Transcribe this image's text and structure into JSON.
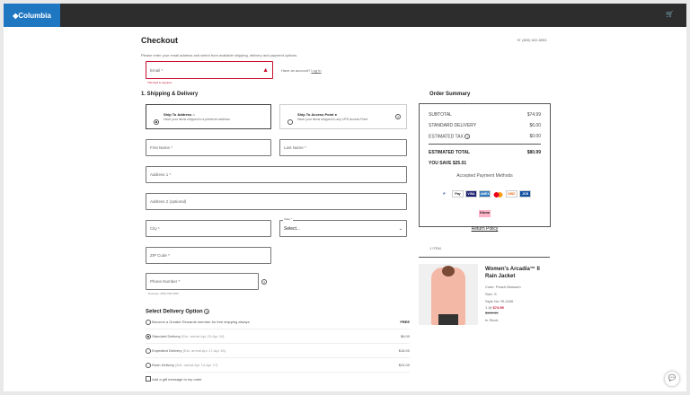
{
  "header": {
    "logo": "◆Columbia",
    "cart_icon": "cart-icon"
  },
  "page": {
    "title": "Checkout",
    "phone": "☏ (800) 622-6953",
    "intro": "Please enter your email address and select from available shipping, delivery and payment options."
  },
  "email": {
    "placeholder": "Email *",
    "error": "This field is required.",
    "account_text": "Have an account?",
    "login": "Log In"
  },
  "shipping": {
    "title": "1. Shipping & Delivery",
    "options": [
      {
        "label": "Ship To Address",
        "desc": "Have your items shipped to a preferred address",
        "selected": true
      },
      {
        "label": "Ship To Access Point",
        "desc": "Have your items shipped to any UPS Access Point",
        "selected": false
      }
    ],
    "fields": {
      "first": "First Name *",
      "last": "Last Name *",
      "addr1": "Address 1 *",
      "addr2": "Address 2 (optional)",
      "city": "City *",
      "state_label": "State *",
      "state_value": "Select...",
      "zip": "ZIP Code *",
      "phone": "Phone Number *",
      "phone_hint": "Example: (555) 555-5555"
    }
  },
  "delivery": {
    "title": "Select Delivery Option",
    "options": [
      {
        "label": "Become a Greater Rewards member for free shipping always",
        "eta": "",
        "price": "FREE",
        "selected": false
      },
      {
        "label": "Standard Delivery",
        "eta": "(Est. arrival Apr 20-Apr 24)",
        "price": "$6.00",
        "selected": true
      },
      {
        "label": "Expedited Delivery",
        "eta": "(Est. arrival Apr 17-Apr 18)",
        "price": "$16.00",
        "selected": false
      },
      {
        "label": "Rush Delivery",
        "eta": "(Est. arrival Apr 14-Apr 17)",
        "price": "$24.00",
        "selected": false
      }
    ],
    "gift": "Add a gift message to my order"
  },
  "summary": {
    "title": "Order Summary",
    "subtotal_label": "SUBTOTAL",
    "subtotal": "$74.99",
    "delivery_label": "STANDARD DELIVERY",
    "delivery": "$6.00",
    "tax_label": "ESTIMATED TAX",
    "tax": "$0.00",
    "total_label": "ESTIMATED TOTAL",
    "total": "$80.99",
    "save": "YOU SAVE $25.01",
    "payment_title": "Accepted Payment Methods",
    "payments": [
      "P",
      "Pay",
      "VISA",
      "AMEX",
      "MC",
      "DISC",
      "JCB",
      "Klarna"
    ],
    "return_policy": "Return Policy"
  },
  "cart": {
    "count": "1 ITEM",
    "product": {
      "name": "Women's Arcadia™ II Rain Jacket",
      "color": "Color: Peach Blossom",
      "size": "Size: S",
      "style": "Style No: RL2436",
      "price_prefix": "1 @",
      "price": "$74.99",
      "orig_price": "$100.00",
      "stock": "In Stock"
    }
  },
  "colors": {
    "brand": "#1f76c1",
    "error": "#c8102e"
  }
}
